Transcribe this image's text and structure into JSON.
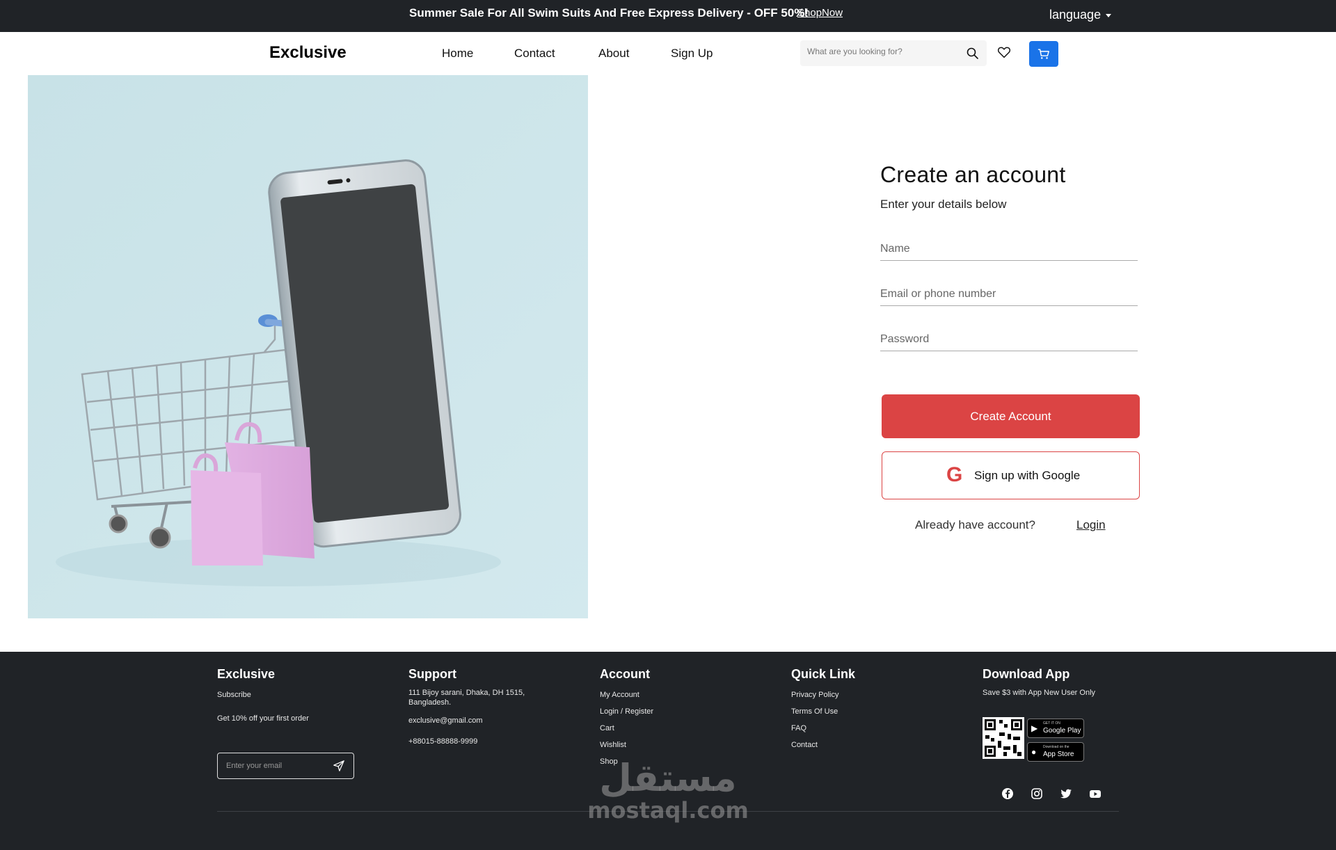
{
  "topbar": {
    "message": "Summer Sale For All Swim Suits And Free Express Delivery - OFF 50%!",
    "shop_now": "ShopNow",
    "language": "language"
  },
  "navbar": {
    "logo": "Exclusive",
    "links": [
      "Home",
      "Contact",
      "About",
      "Sign Up"
    ],
    "search_placeholder": "What are you looking for?"
  },
  "form": {
    "title": "Create an account",
    "subtitle": "Enter your details below",
    "name_placeholder": "Name",
    "email_placeholder": "Email or phone number",
    "password_placeholder": "Password",
    "create_button": "Create Account",
    "google_button": "Sign up with Google",
    "already": "Already have account?",
    "login": "Login"
  },
  "footer": {
    "col1": {
      "title": "Exclusive",
      "subscribe": "Subscribe",
      "offer": "Get 10% off your first order",
      "email_placeholder": "Enter your email"
    },
    "col2": {
      "title": "Support",
      "address_line1": "111 Bijoy sarani, Dhaka, DH 1515,",
      "address_line2": "Bangladesh.",
      "email": "exclusive@gmail.com",
      "phone": "+88015-88888-9999"
    },
    "col3": {
      "title": "Account",
      "items": [
        "My Account",
        "Login / Register",
        "Cart",
        "Wishlist",
        "Shop"
      ]
    },
    "col4": {
      "title": "Quick Link",
      "items": [
        "Privacy Policy",
        "Terms Of Use",
        "FAQ",
        "Contact"
      ]
    },
    "col5": {
      "title": "Download App",
      "subtitle": "Save $3 with App New User Only",
      "google_play_small": "GET IT ON",
      "google_play": "Google Play",
      "app_store_small": "Download on the",
      "app_store": "App Store"
    },
    "social_icons": [
      "facebook-icon",
      "instagram-icon",
      "twitter-icon",
      "youtube-icon"
    ],
    "watermark_ar": "مستقل",
    "watermark_en": "mostaql.com"
  },
  "colors": {
    "accent": "#db4444",
    "primary_blue": "#1a73e8",
    "dark": "#202327"
  }
}
